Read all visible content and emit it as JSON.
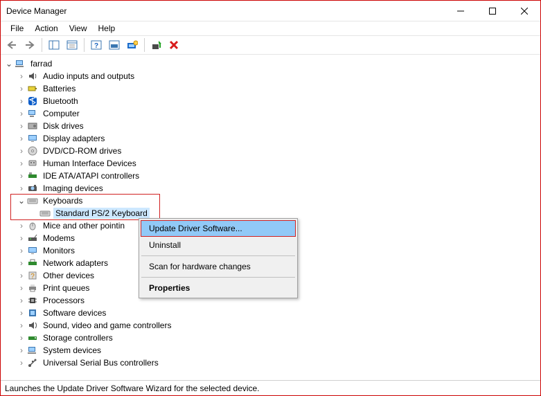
{
  "window": {
    "title": "Device Manager"
  },
  "menubar": [
    "File",
    "Action",
    "View",
    "Help"
  ],
  "root_node": "farrad",
  "categories": [
    {
      "label": "Audio inputs and outputs",
      "icon": "audio"
    },
    {
      "label": "Batteries",
      "icon": "battery"
    },
    {
      "label": "Bluetooth",
      "icon": "bt"
    },
    {
      "label": "Computer",
      "icon": "computer"
    },
    {
      "label": "Disk drives",
      "icon": "disk"
    },
    {
      "label": "Display adapters",
      "icon": "display"
    },
    {
      "label": "DVD/CD-ROM drives",
      "icon": "disc"
    },
    {
      "label": "Human Interface Devices",
      "icon": "hid"
    },
    {
      "label": "IDE ATA/ATAPI controllers",
      "icon": "ide"
    },
    {
      "label": "Imaging devices",
      "icon": "imaging"
    }
  ],
  "keyboards": {
    "label": "Keyboards",
    "child": "Standard PS/2 Keyboard"
  },
  "categories_after": [
    {
      "label": "Mice and other pointin",
      "icon": "mouse"
    },
    {
      "label": "Modems",
      "icon": "modem"
    },
    {
      "label": "Monitors",
      "icon": "monitor"
    },
    {
      "label": "Network adapters",
      "icon": "net"
    },
    {
      "label": "Other devices",
      "icon": "other"
    },
    {
      "label": "Print queues",
      "icon": "printer"
    },
    {
      "label": "Processors",
      "icon": "cpu"
    },
    {
      "label": "Software devices",
      "icon": "soft"
    },
    {
      "label": "Sound, video and game controllers",
      "icon": "sound"
    },
    {
      "label": "Storage controllers",
      "icon": "storage"
    },
    {
      "label": "System devices",
      "icon": "system"
    },
    {
      "label": "Universal Serial Bus controllers",
      "icon": "usb"
    }
  ],
  "context_menu": {
    "update": "Update Driver Software...",
    "uninstall": "Uninstall",
    "scan": "Scan for hardware changes",
    "properties": "Properties"
  },
  "statusbar": "Launches the Update Driver Software Wizard for the selected device."
}
